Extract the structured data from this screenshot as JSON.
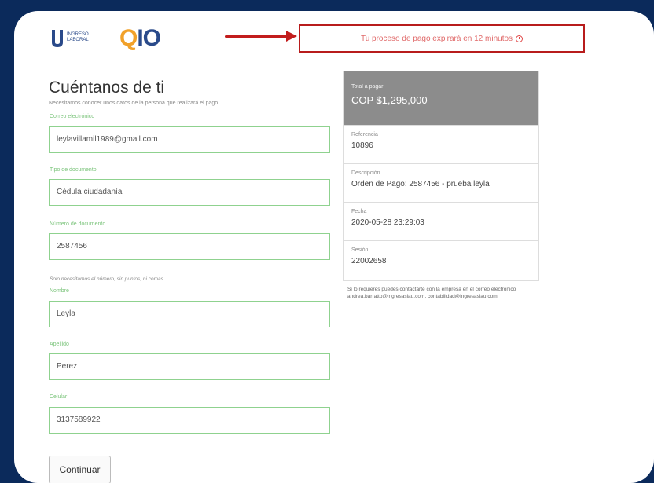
{
  "header": {
    "university_logo_text": "INGRESO LABORAL",
    "brand_logo_q": "Q",
    "brand_logo_rest": "IO",
    "timer_text": "Tu proceso de pago expirará en 12 minutos"
  },
  "form": {
    "title": "Cuéntanos de ti",
    "subtitle": "Necesitamos conocer unos datos de la persona que realizará el pago",
    "fields": [
      {
        "label": "Correo electrónico",
        "value": "leylavillamil1989@gmail.com"
      },
      {
        "label": "Tipo de documento",
        "value": "Cédula ciudadanía"
      },
      {
        "label": "Número de documento",
        "value": "2587456"
      },
      {
        "label": "Nombre",
        "value": "Leyla"
      },
      {
        "label": "Apellido",
        "value": "Perez"
      },
      {
        "label": "Celular",
        "value": "3137589922"
      }
    ],
    "document_hint": "Solo necesitamos el número, sin puntos, ni comas",
    "submit_label": "Continuar"
  },
  "summary": {
    "total_label": "Total a pagar",
    "total_value": "COP $1,295,000",
    "rows": [
      {
        "label": "Referencia",
        "value": "10896"
      },
      {
        "label": "Descripción",
        "value": "Orden de Pago: 2587456 - prueba leyla"
      },
      {
        "label": "Fecha",
        "value": "2020-05-28 23:29:03"
      },
      {
        "label": "Sesión",
        "value": "22002658"
      }
    ],
    "contact_text": "Si lo requieres puedes contactarte con la empresa en el correo electrónico andrea.barratto@ingresaslau.com, contabilidad@ingresaslau.com"
  },
  "colors": {
    "background": "#0b2a5b",
    "field_border": "#8fd28f",
    "alert_red": "#b81c1c",
    "summary_header": "#8c8c8c"
  }
}
